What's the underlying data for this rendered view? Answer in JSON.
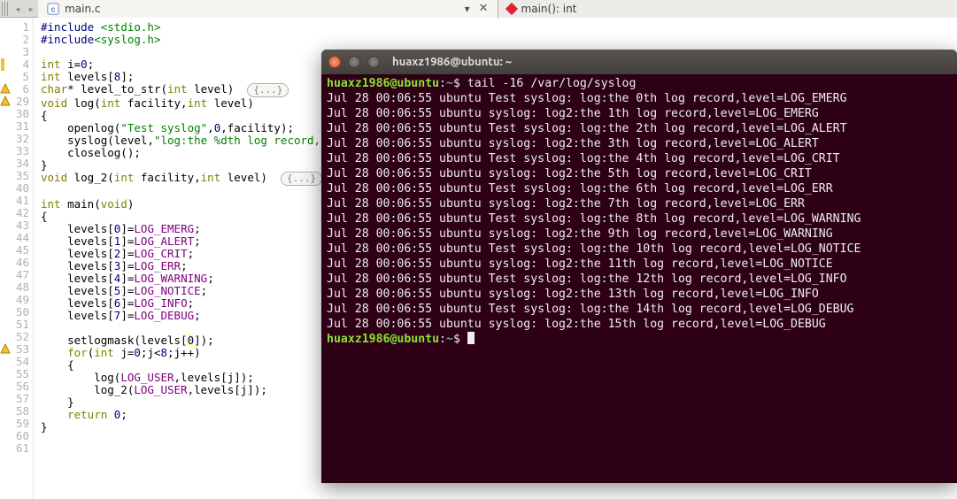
{
  "tabs": {
    "file_tab": "main.c",
    "func_tab": "main(): int"
  },
  "code_lines": [
    {
      "n": 1,
      "html": "<span class='pp'>#include</span> <span class='inc'>&lt;stdio.h&gt;</span>"
    },
    {
      "n": 2,
      "html": "<span class='pp'>#include</span><span class='inc'>&lt;syslog.h&gt;</span>"
    },
    {
      "n": 3,
      "html": ""
    },
    {
      "n": 4,
      "html": "<span class='kw'>int</span> i=<span class='num'>0</span>;",
      "yellow": true
    },
    {
      "n": 5,
      "html": "<span class='kw'>int</span> levels[<span class='num'>8</span>];"
    },
    {
      "n": 6,
      "html": "<span class='kw'>char</span>* level_to_str(<span class='kw'>int</span> level)  <span class='fold-stub'>{...}</span>",
      "warn": true
    },
    {
      "n": 29,
      "html": "<span class='kw'>void</span> log(<span class='kw'>int</span> facility,<span class='kw'>int</span> level)",
      "warn": true
    },
    {
      "n": 30,
      "html": "{"
    },
    {
      "n": 31,
      "html": "    openlog(<span class='str'>\"Test syslog\"</span>,<span class='num'>0</span>,facility);"
    },
    {
      "n": 32,
      "html": "    syslog(level,<span class='str'>\"log:the %dth log record,le</span>"
    },
    {
      "n": 33,
      "html": "    closelog();"
    },
    {
      "n": 34,
      "html": "}"
    },
    {
      "n": 35,
      "html": "<span class='kw'>void</span> log_2(<span class='kw'>int</span> facility,<span class='kw'>int</span> level)  <span class='fold-stub'>{...}</span>"
    },
    {
      "n": 40,
      "html": ""
    },
    {
      "n": 41,
      "html": "<span class='kw'>int</span> main(<span class='kw'>void</span>)"
    },
    {
      "n": 42,
      "html": "{"
    },
    {
      "n": 43,
      "html": "    levels[<span class='num'>0</span>]=<span class='mac'>LOG_EMERG</span>;"
    },
    {
      "n": 44,
      "html": "    levels[<span class='num'>1</span>]=<span class='mac'>LOG_ALERT</span>;"
    },
    {
      "n": 45,
      "html": "    levels[<span class='num'>2</span>]=<span class='mac'>LOG_CRIT</span>;"
    },
    {
      "n": 46,
      "html": "    levels[<span class='num'>3</span>]=<span class='mac'>LOG_ERR</span>;"
    },
    {
      "n": 47,
      "html": "    levels[<span class='num'>4</span>]=<span class='mac'>LOG_WARNING</span>;"
    },
    {
      "n": 48,
      "html": "    levels[<span class='num'>5</span>]=<span class='mac'>LOG_NOTICE</span>;"
    },
    {
      "n": 49,
      "html": "    levels[<span class='num'>6</span>]=<span class='mac'>LOG_INFO</span>;"
    },
    {
      "n": 50,
      "html": "    levels[<span class='num'>7</span>]=<span class='mac'>LOG_DEBUG</span>;"
    },
    {
      "n": 51,
      "html": ""
    },
    {
      "n": 52,
      "html": "    setlogmask(levels[<span class='num' style='background:#ffffb0'>0</span>]);"
    },
    {
      "n": 53,
      "html": "    <span class='kw'>for</span>(<span class='kw'>int</span> j=<span class='num'>0</span>;j&lt;<span class='num'>8</span>;j++)",
      "warn": true
    },
    {
      "n": 54,
      "html": "    {"
    },
    {
      "n": 55,
      "html": "        log(<span class='mac'>LOG_USER</span>,levels[j]);"
    },
    {
      "n": 56,
      "html": "        log_2(<span class='mac'>LOG_USER</span>,levels[j]);"
    },
    {
      "n": 57,
      "html": "    }"
    },
    {
      "n": 58,
      "html": "    <span class='kw'>return</span> <span class='num'>0</span>;"
    },
    {
      "n": 59,
      "html": "}"
    },
    {
      "n": 60,
      "html": ""
    },
    {
      "n": 61,
      "html": ""
    }
  ],
  "terminal": {
    "title": "huaxz1986@ubuntu: ~",
    "prompt_user": "huaxz1986@ubuntu",
    "prompt_path": "~",
    "command": "tail -16 /var/log/syslog",
    "lines": [
      "Jul 28 00:06:55 ubuntu Test syslog: log:the 0th log record,level=LOG_EMERG",
      "Jul 28 00:06:55 ubuntu syslog: log2:the 1th log record,level=LOG_EMERG",
      "Jul 28 00:06:55 ubuntu Test syslog: log:the 2th log record,level=LOG_ALERT",
      "Jul 28 00:06:55 ubuntu syslog: log2:the 3th log record,level=LOG_ALERT",
      "Jul 28 00:06:55 ubuntu Test syslog: log:the 4th log record,level=LOG_CRIT",
      "Jul 28 00:06:55 ubuntu syslog: log2:the 5th log record,level=LOG_CRIT",
      "Jul 28 00:06:55 ubuntu Test syslog: log:the 6th log record,level=LOG_ERR",
      "Jul 28 00:06:55 ubuntu syslog: log2:the 7th log record,level=LOG_ERR",
      "Jul 28 00:06:55 ubuntu Test syslog: log:the 8th log record,level=LOG_WARNING",
      "Jul 28 00:06:55 ubuntu syslog: log2:the 9th log record,level=LOG_WARNING",
      "Jul 28 00:06:55 ubuntu Test syslog: log:the 10th log record,level=LOG_NOTICE",
      "Jul 28 00:06:55 ubuntu syslog: log2:the 11th log record,level=LOG_NOTICE",
      "Jul 28 00:06:55 ubuntu Test syslog: log:the 12th log record,level=LOG_INFO",
      "Jul 28 00:06:55 ubuntu syslog: log2:the 13th log record,level=LOG_INFO",
      "Jul 28 00:06:55 ubuntu Test syslog: log:the 14th log record,level=LOG_DEBUG",
      "Jul 28 00:06:55 ubuntu syslog: log2:the 15th log record,level=LOG_DEBUG"
    ]
  }
}
